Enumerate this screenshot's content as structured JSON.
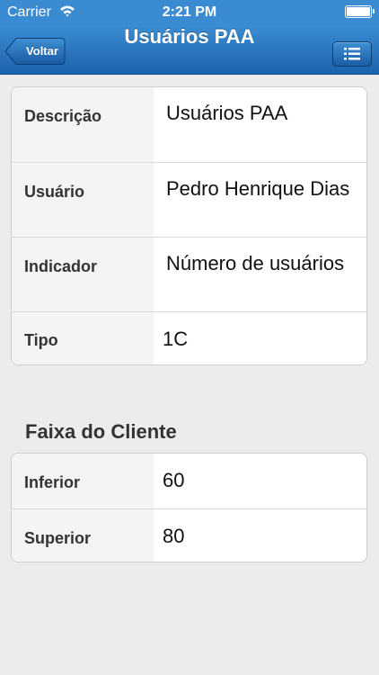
{
  "status_bar": {
    "carrier": "Carrier",
    "time": "2:21 PM",
    "wifi_icon": "wifi-icon",
    "battery_icon": "battery-icon"
  },
  "nav": {
    "title": "Usuários PAA",
    "back_label": "Voltar",
    "menu_icon": "list-icon"
  },
  "details": [
    {
      "label": "Descrição",
      "value": "Usuários PAA"
    },
    {
      "label": "Usuário",
      "value": "Pedro Henrique Dias"
    },
    {
      "label": "Indicador",
      "value": "Número de usuários"
    },
    {
      "label": "Tipo",
      "value": "1C"
    }
  ],
  "client_range": {
    "header": "Faixa do Cliente",
    "rows": [
      {
        "label": "Inferior",
        "value": "60"
      },
      {
        "label": "Superior",
        "value": "80"
      }
    ]
  },
  "colors": {
    "nav_top": "#3b8ed3",
    "nav_bottom": "#1d62ad",
    "background": "#ececec"
  }
}
